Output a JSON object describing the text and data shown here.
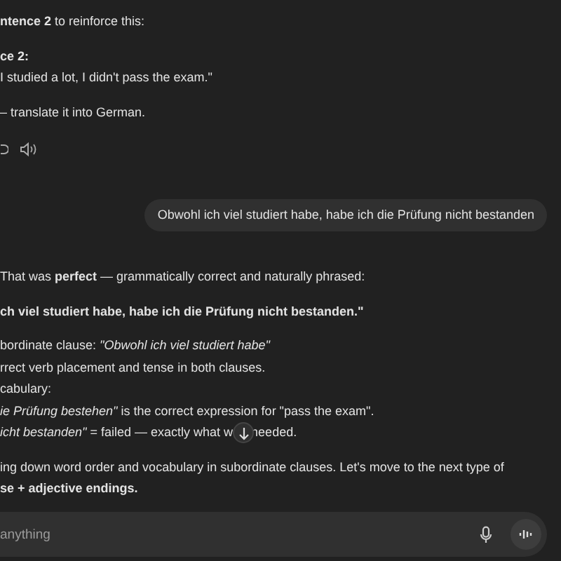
{
  "messages": [
    {
      "kind": "assistant",
      "blocks": [
        {
          "lines": [
            {
              "kind": "text",
              "text": "**ntence 2** to reinforce this:"
            }
          ]
        },
        {
          "lines": [
            {
              "kind": "strong",
              "text": "ce 2:"
            },
            {
              "kind": "text",
              "text": "I studied a lot, I didn't pass the exam.\""
            }
          ]
        },
        {
          "lines": [
            {
              "kind": "text",
              "text": "– translate it into German."
            }
          ]
        },
        {
          "lines": [
            {
              "kind": "actions"
            }
          ]
        }
      ]
    },
    {
      "kind": "user",
      "text": "Obwohl ich viel studiert habe, habe ich die Prüfung nicht bestanden"
    },
    {
      "kind": "assistant",
      "blocks": [
        {
          "lines": [
            {
              "kind": "text",
              "text": "That was **perfect** — grammatically correct and naturally phrased:"
            }
          ]
        },
        {
          "lines": [
            {
              "kind": "strong",
              "text": "ch viel studiert habe, habe ich die Prüfung nicht bestanden.\""
            }
          ]
        },
        {
          "lines": [
            {
              "kind": "text",
              "text": "bordinate clause: *\"Obwohl ich viel studiert habe\"*"
            },
            {
              "kind": "text",
              "text": "rrect verb placement and tense in both clauses."
            },
            {
              "kind": "text",
              "text": "cabulary:"
            },
            {
              "kind": "text",
              "text": "*ie Prüfung bestehen\"* is the correct expression for \"pass the exam\"."
            },
            {
              "kind": "covered",
              "parts": [
                "*icht bestanden\"* = failed — exactly what w",
                "needed."
              ]
            }
          ]
        },
        {
          "lines": [
            {
              "kind": "text",
              "text": "ing down word order and vocabulary in subordinate clauses. Let's move to the next type of"
            },
            {
              "kind": "text",
              "text": "**se + adjective endings.**"
            }
          ]
        }
      ]
    }
  ],
  "composer": {
    "placeholder": "anything"
  }
}
